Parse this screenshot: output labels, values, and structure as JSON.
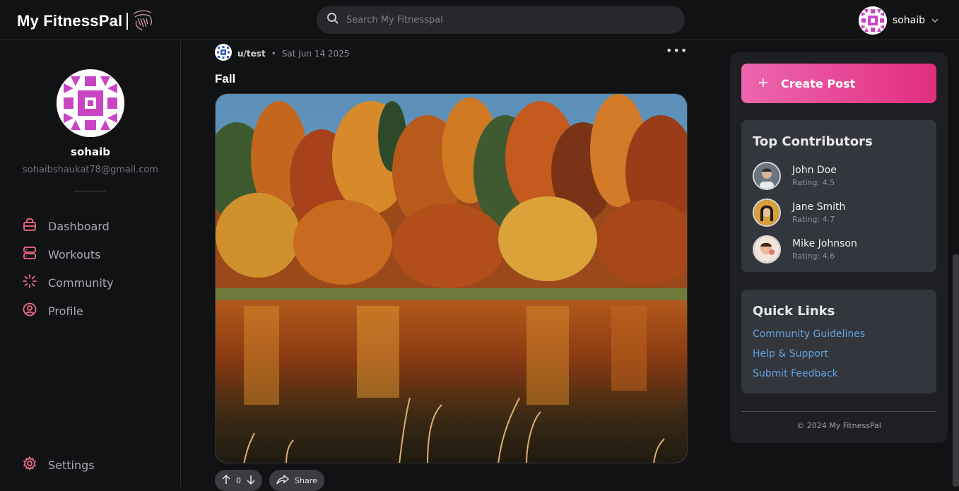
{
  "header": {
    "logo_text": "My FitnessPal",
    "logo_icon": "hand-swirl-logo-icon",
    "search_placeholder": "Search My Fitnesspal",
    "user_name": "sohaib"
  },
  "sidebar": {
    "profile": {
      "name": "sohaib",
      "email": "sohaibshaukat78@gmail.com"
    },
    "items": [
      {
        "label": "Dashboard",
        "icon": "briefcase-icon"
      },
      {
        "label": "Workouts",
        "icon": "server-icon"
      },
      {
        "label": "Community",
        "icon": "loader-icon"
      },
      {
        "label": "Profile",
        "icon": "user-circle-icon"
      }
    ],
    "settings_label": "Settings",
    "accent_color": "#f26b86"
  },
  "post": {
    "user": "u/test",
    "separator": "•",
    "date": "Sat Jun 14 2025",
    "more": "•••",
    "title": "Fall",
    "image_description": "autumn-forest-lake",
    "vote_count": "0",
    "share_label": "Share"
  },
  "right_panel": {
    "create_post_label": "Create Post",
    "top_contributors": {
      "title": "Top Contributors",
      "items": [
        {
          "name": "John Doe",
          "rating": "Rating: 4.5"
        },
        {
          "name": "Jane Smith",
          "rating": "Rating: 4.7"
        },
        {
          "name": "Mike Johnson",
          "rating": "Rating: 4.6"
        }
      ]
    },
    "quick_links": {
      "title": "Quick Links",
      "items": [
        "Community Guidelines",
        "Help & Support",
        "Submit Feedback"
      ]
    },
    "footer": "© 2024 My FitnessPal"
  },
  "colors": {
    "accent_pink": "#e02e7f",
    "link_blue": "#66a3e0",
    "background": "#111214"
  }
}
